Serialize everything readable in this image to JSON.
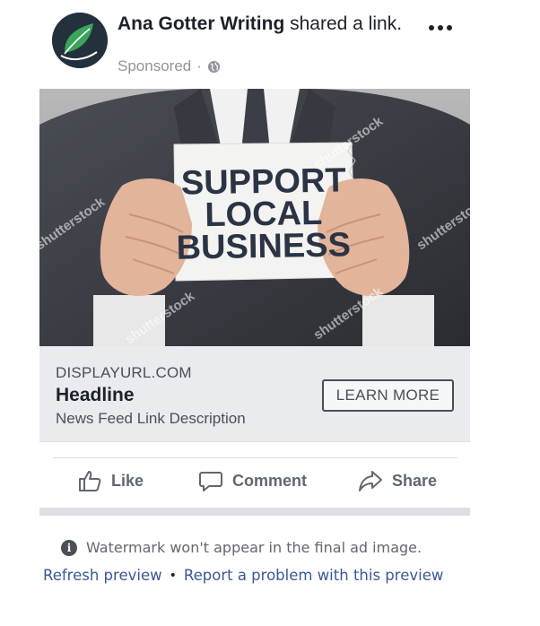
{
  "post": {
    "author": "Ana Gotter Writing",
    "action_text": "shared a link.",
    "sponsored_label": "Sponsored",
    "meta_separator": "·",
    "audience_icon": "globe-icon"
  },
  "ad": {
    "image_sign_lines": [
      "SUPPORT",
      "LOCAL",
      "BUSINESS"
    ],
    "watermark_text": "shutterstock",
    "display_url": "DISPLAYURL.COM",
    "headline": "Headline",
    "description": "News Feed Link Description",
    "cta_label": "LEARN MORE"
  },
  "actions": {
    "like": "Like",
    "comment": "Comment",
    "share": "Share"
  },
  "notice": {
    "text": "Watermark won't appear in the final ad image.",
    "refresh_link": "Refresh preview",
    "separator": "•",
    "report_link": "Report a problem with this preview"
  },
  "colors": {
    "link_blue": "#385898",
    "gray_text": "#606770",
    "link_box_bg": "#e9ebee",
    "avatar_green": "#3aa55a"
  }
}
